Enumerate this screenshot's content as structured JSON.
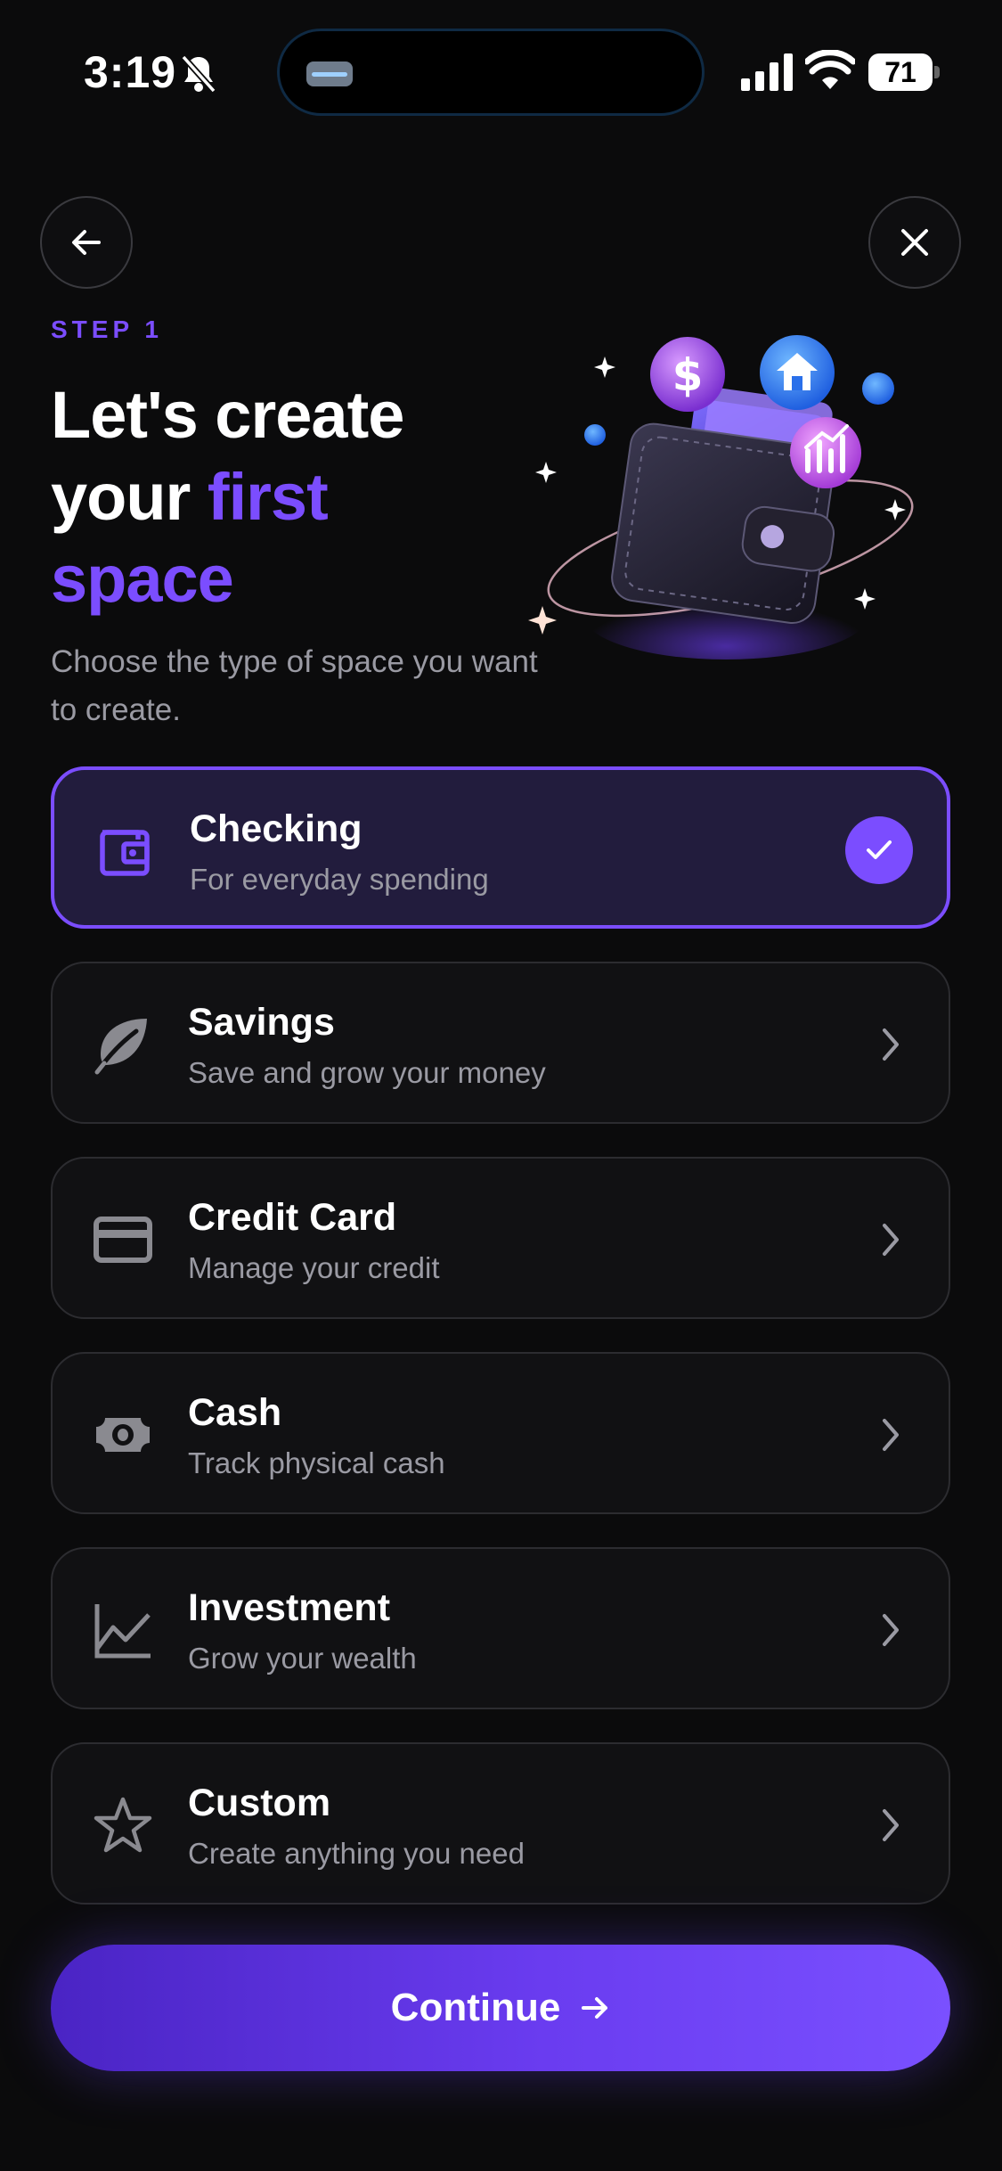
{
  "status_bar": {
    "time": "3:19",
    "battery": "71"
  },
  "header": {
    "step_label": "STEP 1"
  },
  "headline": {
    "line1": "Let's create",
    "line2_plain": "your ",
    "line2_accent": "first",
    "line3_accent": "space"
  },
  "subtitle": "Choose the type of space you want to create.",
  "options": [
    {
      "title": "Checking",
      "description": "For everyday spending",
      "icon": "wallet-icon",
      "selected": true
    },
    {
      "title": "Savings",
      "description": "Save and grow your money",
      "icon": "leaf-icon",
      "selected": false
    },
    {
      "title": "Credit Card",
      "description": "Manage your credit",
      "icon": "credit-card-icon",
      "selected": false
    },
    {
      "title": "Cash",
      "description": "Track physical cash",
      "icon": "banknote-icon",
      "selected": false
    },
    {
      "title": "Investment",
      "description": "Grow your wealth",
      "icon": "chart-line-icon",
      "selected": false
    },
    {
      "title": "Custom",
      "description": "Create anything you need",
      "icon": "star-icon",
      "selected": false
    }
  ],
  "continue_button": {
    "label": "Continue"
  },
  "colors": {
    "accent": "#7b4dff",
    "background": "#0b0b0c",
    "card": "#111113",
    "selected_card": "#221c3d",
    "muted_text": "#9a9aa3"
  }
}
